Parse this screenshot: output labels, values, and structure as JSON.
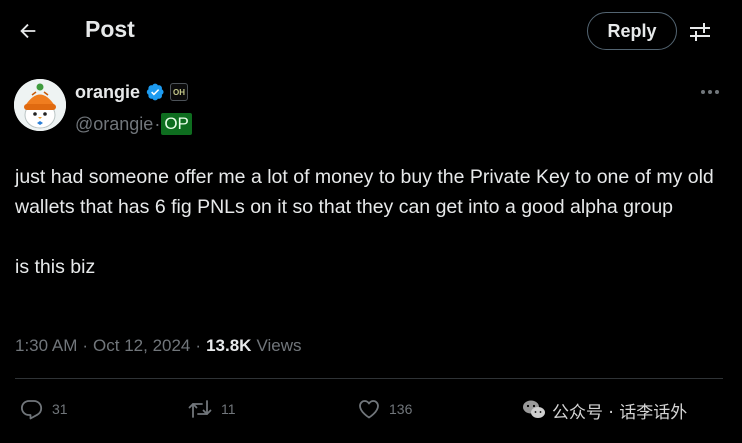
{
  "header": {
    "title": "Post",
    "reply_label": "Reply",
    "icons": {
      "back": "arrow-left-icon",
      "settings": "sliders-icon"
    }
  },
  "author": {
    "display_name": "orangie",
    "handle": "@orangie",
    "handle_separator": "·",
    "op_tag": "OP",
    "affiliate_badge": "OH",
    "verified": true,
    "avatar_icon": "orange-hat-duck-avatar"
  },
  "tweet": {
    "text": "just had someone offer me a lot of money to buy the Private Key to one of my old wallets that has 6 fig PNLs on it so that they can get into a good alpha group\n\nis this biz"
  },
  "meta": {
    "time": "1:30 AM",
    "separator": "·",
    "date": "Oct 12, 2024",
    "views_count": "13.8K",
    "views_label": "Views"
  },
  "actions": {
    "replies": "31",
    "reposts": "11",
    "likes": "136"
  },
  "watermark": {
    "text": "公众号 · 话李话外"
  },
  "colors": {
    "background": "#000000",
    "text": "#e7e9ea",
    "muted": "#71767b",
    "verified": "#1d9bf0",
    "op_tag": "#0e6d1f",
    "divider": "#2f3336"
  }
}
